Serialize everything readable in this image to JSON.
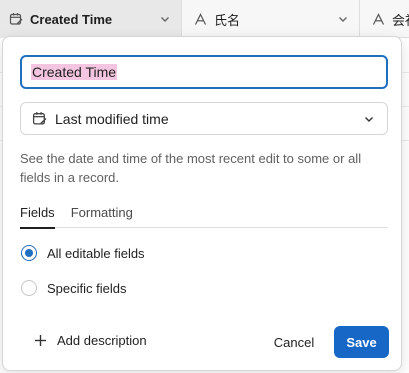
{
  "grid_header": {
    "columns": [
      {
        "label": "Created Time",
        "icon": "calendar-edit-icon"
      },
      {
        "label": "氏名",
        "icon": "text-field-icon"
      },
      {
        "label": "会社",
        "icon": "text-field-icon"
      }
    ]
  },
  "field_editor": {
    "name_value": "Created Time",
    "field_type": {
      "label": "Last modified time",
      "icon": "calendar-edit-icon"
    },
    "description": "See the date and time of the most recent edit to some or all fields in a record.",
    "tabs": [
      {
        "label": "Fields",
        "active": true
      },
      {
        "label": "Formatting",
        "active": false
      }
    ],
    "options": [
      {
        "label": "All editable fields",
        "checked": true
      },
      {
        "label": "Specific fields",
        "checked": false
      }
    ],
    "add_description_label": "Add description",
    "cancel_label": "Cancel",
    "save_label": "Save"
  },
  "colors": {
    "accent": "#1767c7",
    "input_focus": "#1f6fbf",
    "text_selection": "#f4c5e1"
  }
}
